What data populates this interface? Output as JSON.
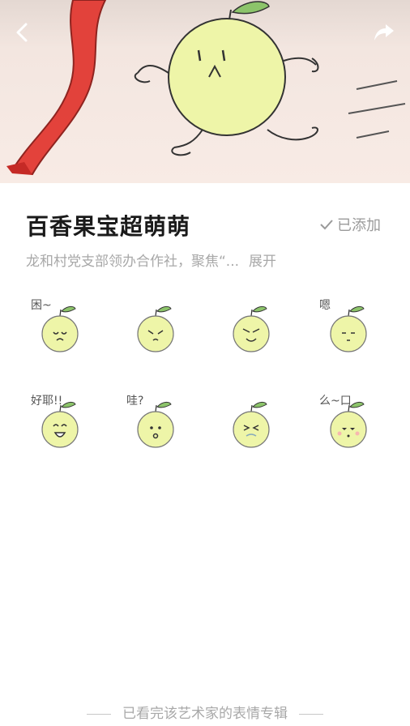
{
  "header": {
    "back_icon": "chevron-left-icon",
    "share_icon": "share-arrow-icon"
  },
  "pack": {
    "title": "百香果宝超萌萌",
    "added_label": "已添加",
    "description": "龙和村党支部领办合作社，聚焦“...",
    "expand_label": "展开"
  },
  "stickers": [
    {
      "caption": "困~"
    },
    {
      "caption": ""
    },
    {
      "caption": ""
    },
    {
      "caption": "嗯"
    },
    {
      "caption": "好耶!!"
    },
    {
      "caption": "哇?"
    },
    {
      "caption": ""
    },
    {
      "caption": "么~口"
    }
  ],
  "footer": {
    "text": "已看完该艺术家的表情专辑"
  },
  "colors": {
    "fruit": "#eef5a8",
    "leaf": "#8cc46a",
    "ribbon": "#e23a33"
  }
}
